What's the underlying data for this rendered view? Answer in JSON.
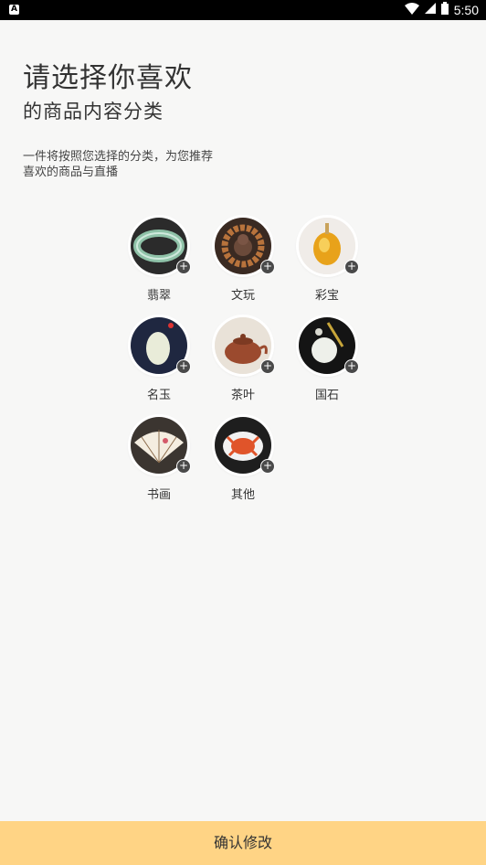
{
  "status_bar": {
    "time": "5:50",
    "icons": [
      "wifi-icon",
      "cell-signal-icon",
      "battery-icon"
    ]
  },
  "header": {
    "title": "请选择你喜欢",
    "subtitle": "的商品内容分类",
    "description_line1": "一件将按照您选择的分类，为您推荐",
    "description_line2": "喜欢的商品与直播"
  },
  "categories": [
    {
      "label": "翡翠",
      "icon": "jade-bracelet-image"
    },
    {
      "label": "文玩",
      "icon": "buddha-beads-image"
    },
    {
      "label": "彩宝",
      "icon": "amber-gem-image"
    },
    {
      "label": "名玉",
      "icon": "white-jade-pendant-image"
    },
    {
      "label": "茶叶",
      "icon": "teapot-image"
    },
    {
      "label": "国石",
      "icon": "stone-pendant-image"
    },
    {
      "label": "书画",
      "icon": "fan-painting-image"
    },
    {
      "label": "其他",
      "icon": "crab-dish-image"
    }
  ],
  "add_symbol": "+",
  "footer": {
    "confirm_label": "确认修改"
  },
  "colors": {
    "confirm_bg": "#ffd485",
    "plus_badge": "#4a4a4a"
  }
}
